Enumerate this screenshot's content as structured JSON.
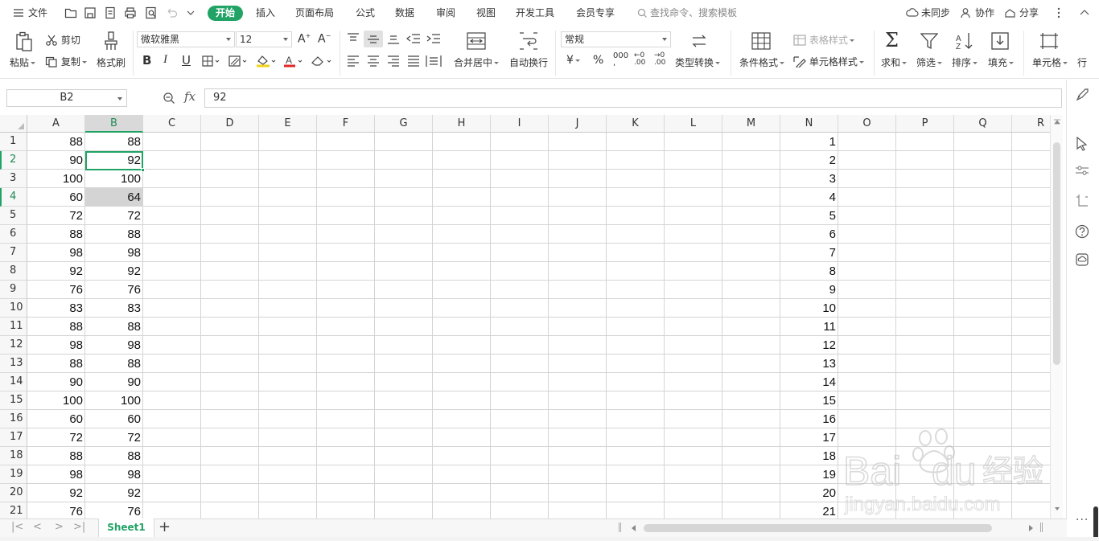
{
  "menubar": {
    "menu": "文件",
    "tabs": [
      "开始",
      "插入",
      "页面布局",
      "公式",
      "数据",
      "审阅",
      "视图",
      "开发工具",
      "会员专享"
    ],
    "search_placeholder": "查找命令、搜索模板",
    "sync": "未同步",
    "collab": "协作",
    "share": "分享"
  },
  "ribbon": {
    "paste": "粘贴",
    "cut": "剪切",
    "copy": "复制",
    "format_painter": "格式刷",
    "font_name": "微软雅黑",
    "font_size": "12",
    "merge_center": "合并居中",
    "wrap_text": "自动换行",
    "number_format": "常规",
    "type_convert": "类型转换",
    "cond_format": "条件格式",
    "table_style": "表格样式",
    "cell_style": "单元格样式",
    "sum": "求和",
    "filter": "筛选",
    "sort": "排序",
    "fill": "填充",
    "cell": "单元格",
    "row_col": "行"
  },
  "formula_bar": {
    "name_box": "B2",
    "fx": "fx",
    "value": "92"
  },
  "grid": {
    "columns": [
      "A",
      "B",
      "C",
      "D",
      "E",
      "F",
      "G",
      "H",
      "I",
      "J",
      "K",
      "L",
      "M",
      "N",
      "O",
      "P",
      "Q",
      "R"
    ],
    "selected_column": "B",
    "selected_rows": [
      2,
      4
    ],
    "active_cell": "B2",
    "highlight_cell": "B4",
    "rows": [
      {
        "n": "1",
        "a": "88",
        "b": "88"
      },
      {
        "n": "2",
        "a": "90",
        "b": "92"
      },
      {
        "n": "3",
        "a": "100",
        "b": "100"
      },
      {
        "n": "4",
        "a": "60",
        "b": "64"
      },
      {
        "n": "5",
        "a": "72",
        "b": "72"
      },
      {
        "n": "6",
        "a": "88",
        "b": "88"
      },
      {
        "n": "7",
        "a": "98",
        "b": "98"
      },
      {
        "n": "8",
        "a": "92",
        "b": "92"
      },
      {
        "n": "9",
        "a": "76",
        "b": "76"
      },
      {
        "n": "10",
        "a": "83",
        "b": "83"
      },
      {
        "n": "11",
        "a": "88",
        "b": "88"
      },
      {
        "n": "12",
        "a": "98",
        "b": "98"
      },
      {
        "n": "13",
        "a": "88",
        "b": "88"
      },
      {
        "n": "14",
        "a": "90",
        "b": "90"
      },
      {
        "n": "15",
        "a": "100",
        "b": "100"
      },
      {
        "n": "16",
        "a": "60",
        "b": "60"
      },
      {
        "n": "17",
        "a": "72",
        "b": "72"
      },
      {
        "n": "18",
        "a": "88",
        "b": "88"
      },
      {
        "n": "19",
        "a": "98",
        "b": "98"
      },
      {
        "n": "20",
        "a": "92",
        "b": "92"
      },
      {
        "n": "21",
        "a": "76",
        "b": "76"
      }
    ]
  },
  "sheets": {
    "active": "Sheet1"
  },
  "watermark": {
    "brand": "Bai经验",
    "url": "jingyan.baidu.com"
  },
  "colors": {
    "accent": "#21a366",
    "grid_line": "#d4d4d4",
    "highlight": "#d4d4d4"
  }
}
